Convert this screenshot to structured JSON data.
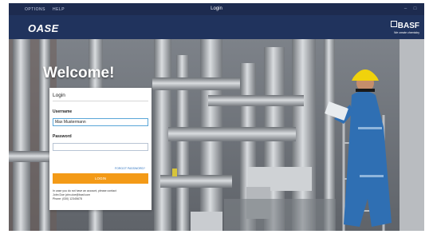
{
  "titlebar": {
    "menu_options": "OPTIONS",
    "menu_help": "HELP",
    "title": "Login"
  },
  "brand": {
    "app_logo": "OASE",
    "company": "BASF",
    "tagline": "We create chemistry"
  },
  "hero": {
    "welcome": "Welcome!"
  },
  "login": {
    "title": "Login",
    "username_label": "Username",
    "username_value": "Max Mustermann",
    "password_label": "Password",
    "password_value": "",
    "forgot_label": "FORGOT PASSWORD?",
    "login_button": "LOGIN",
    "info_line1": "In case you do not have an account, please contact",
    "info_line2": "John Doe john.doe@basf.com",
    "info_line3": "Phone: (030) 12345678"
  },
  "colors": {
    "titlebar": "#1d2b4f",
    "brandbar": "#20335d",
    "accent": "#f39a17",
    "link": "#2f74c0"
  }
}
